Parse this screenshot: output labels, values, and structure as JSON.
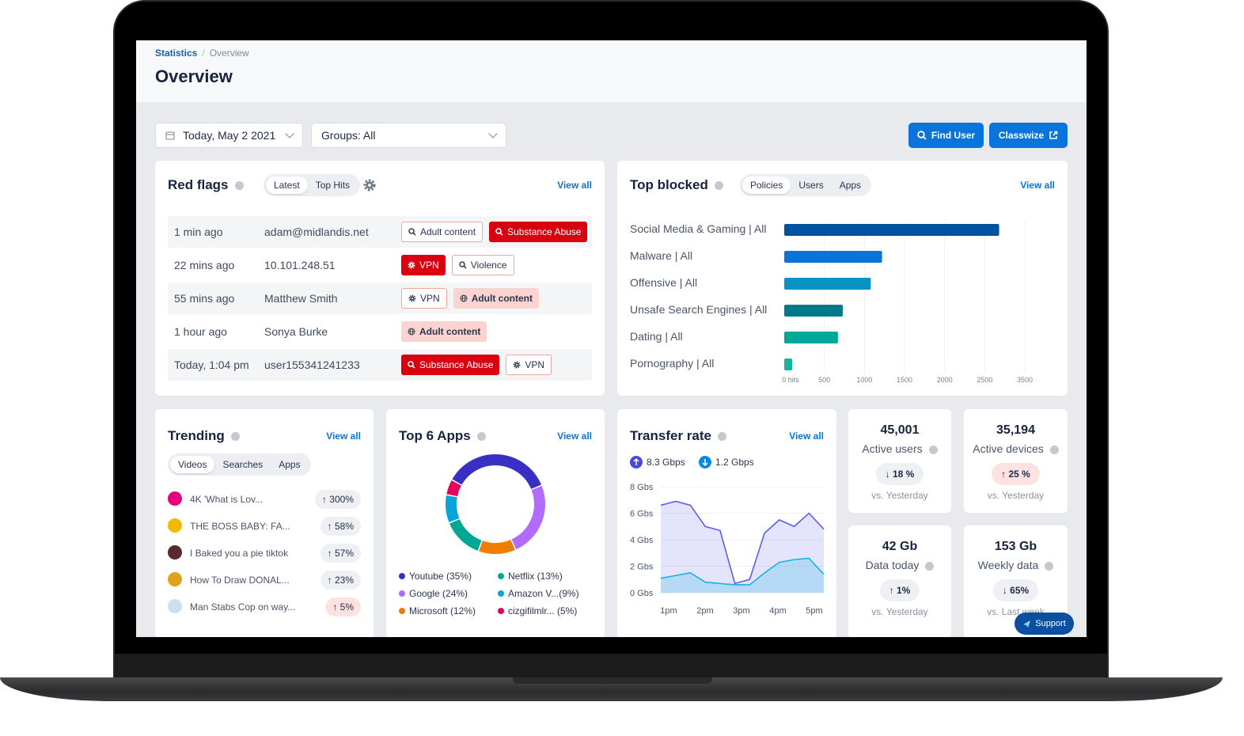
{
  "breadcrumb": {
    "parent": "Statistics",
    "separator": "/",
    "current": "Overview"
  },
  "page_title": "Overview",
  "filters": {
    "date": "Today, May 2 2021",
    "groups": "Groups: All"
  },
  "actions": {
    "find_user": "Find User",
    "classwize": "Classwize"
  },
  "red_flags": {
    "title": "Red flags",
    "tabs": [
      "Latest",
      "Top Hits"
    ],
    "active_tab": "Latest",
    "view_all": "View all",
    "rows": [
      {
        "time": "1 min ago",
        "user": "adam@midlandis.net",
        "tags": [
          {
            "label": "Adult content",
            "style": "outline",
            "icon": "search-icon"
          },
          {
            "label": "Substance Abuse",
            "style": "solid",
            "icon": "search-icon"
          }
        ]
      },
      {
        "time": "22 mins ago",
        "user": "10.101.248.51",
        "tags": [
          {
            "label": "VPN",
            "style": "solid",
            "icon": "gear-icon"
          },
          {
            "label": "Violence",
            "style": "outline",
            "icon": "search-icon"
          }
        ]
      },
      {
        "time": "55 mins ago",
        "user": "Matthew Smith",
        "tags": [
          {
            "label": "VPN",
            "style": "outline",
            "icon": "gear-icon"
          },
          {
            "label": "Adult content",
            "style": "soft",
            "icon": "globe-icon"
          }
        ]
      },
      {
        "time": "1 hour ago",
        "user": "Sonya Burke",
        "tags": [
          {
            "label": "Adult content",
            "style": "soft",
            "icon": "globe-icon"
          }
        ]
      },
      {
        "time": "Today, 1:04 pm",
        "user": "user155341241233",
        "tags": [
          {
            "label": "Substance Abuse",
            "style": "solid",
            "icon": "search-icon"
          },
          {
            "label": "VPN",
            "style": "outline",
            "icon": "gear-icon"
          }
        ]
      }
    ]
  },
  "top_blocked": {
    "title": "Top blocked",
    "tabs": [
      "Policies",
      "Users",
      "Apps"
    ],
    "active_tab": "Policies",
    "view_all": "View all"
  },
  "trending": {
    "title": "Trending",
    "tabs": [
      "Videos",
      "Searches",
      "Apps"
    ],
    "active_tab": "Videos",
    "view_all": "View all",
    "items": [
      {
        "name": "4K 'What is Lov...",
        "change": "↑ 300%",
        "highlight": false,
        "color": "#e6007e"
      },
      {
        "name": "THE BOSS BABY: FA...",
        "change": "↑ 58%",
        "highlight": false,
        "color": "#f5b800"
      },
      {
        "name": "I Baked you a pie tiktok",
        "change": "↑ 57%",
        "highlight": false,
        "color": "#5a2a2a"
      },
      {
        "name": "How To Draw DONAL...",
        "change": "↑ 23%",
        "highlight": false,
        "color": "#e0a21a"
      },
      {
        "name": "Man Stabs Cop on way...",
        "change": "↑ 5%",
        "highlight": true,
        "color": "#c9dff2"
      }
    ]
  },
  "top_apps": {
    "title": "Top 6 Apps",
    "view_all": "View all"
  },
  "transfer_rate": {
    "title": "Transfer rate",
    "view_all": "View all",
    "upload": "8.3 Gbps",
    "download": "1.2 Gbps"
  },
  "stats": [
    {
      "value": "45,001",
      "label": "Active users",
      "change": "↓ 18 %",
      "compare": "vs. Yesterday",
      "highlight": false
    },
    {
      "value": "35,194",
      "label": "Active devices",
      "change": "↑ 25 %",
      "compare": "vs. Yesterday",
      "highlight": true
    },
    {
      "value": "42 Gb",
      "label": "Data today",
      "change": "↑ 1%",
      "compare": "vs. Yesterday",
      "highlight": false
    },
    {
      "value": "153 Gb",
      "label": "Weekly data",
      "change": "↓ 65%",
      "compare": "vs. Last week",
      "highlight": false
    }
  ],
  "support": "Support",
  "chart_data": [
    {
      "type": "bar",
      "orientation": "horizontal",
      "title": "Top blocked",
      "categories": [
        "Social Media & Gaming | All",
        "Malware | All",
        "Offensive | All",
        "Unsafe Search Engines | All",
        "Dating | All",
        "Pornography | All"
      ],
      "values": [
        2680,
        1220,
        1080,
        730,
        670,
        100
      ],
      "colors": [
        "#0052a0",
        "#0a74da",
        "#0893c5",
        "#00798a",
        "#00a89a",
        "#16b39e"
      ],
      "tick_labels": [
        "0 hits",
        "500",
        "1000",
        "1500",
        "2000",
        "2500",
        "3500"
      ],
      "xlim": [
        0,
        3500
      ],
      "grid": true
    },
    {
      "type": "pie",
      "donut": true,
      "title": "Top 6 Apps",
      "categories": [
        "Youtube (35%)",
        "Google (24%)",
        "Microsoft (12%)",
        "Netflix (13%)",
        "Amazon V...(9%)",
        "cizgifilmlr... (5%)"
      ],
      "values": [
        35,
        24,
        12,
        13,
        9,
        5
      ],
      "colors": [
        "#3a2fc4",
        "#b26bff",
        "#f07d00",
        "#00a893",
        "#0aa3dc",
        "#e8005c"
      ]
    },
    {
      "type": "area",
      "title": "Transfer rate",
      "x": [
        "1pm",
        "",
        "",
        "2pm",
        "",
        "3pm",
        "",
        "",
        "4pm",
        "",
        "5pm",
        ""
      ],
      "xtick_labels": [
        "1pm",
        "2pm",
        "3pm",
        "4pm",
        "5pm"
      ],
      "ytick_labels": [
        "0 Gbs",
        "2 Gbs",
        "4 Gbs",
        "6 Gbs",
        "8 Gbs"
      ],
      "ylim": [
        0,
        8
      ],
      "series": [
        {
          "name": "Upload",
          "color": "#5b5ef0",
          "values": [
            6.6,
            6.9,
            6.6,
            5.0,
            4.7,
            0.7,
            1.0,
            4.5,
            5.5,
            5.0,
            6.0,
            4.8
          ]
        },
        {
          "name": "Download",
          "color": "#14b4e0",
          "values": [
            1.1,
            1.3,
            1.5,
            0.8,
            0.7,
            0.6,
            0.6,
            1.5,
            2.3,
            2.5,
            2.6,
            1.4
          ]
        }
      ],
      "grid": true
    }
  ]
}
